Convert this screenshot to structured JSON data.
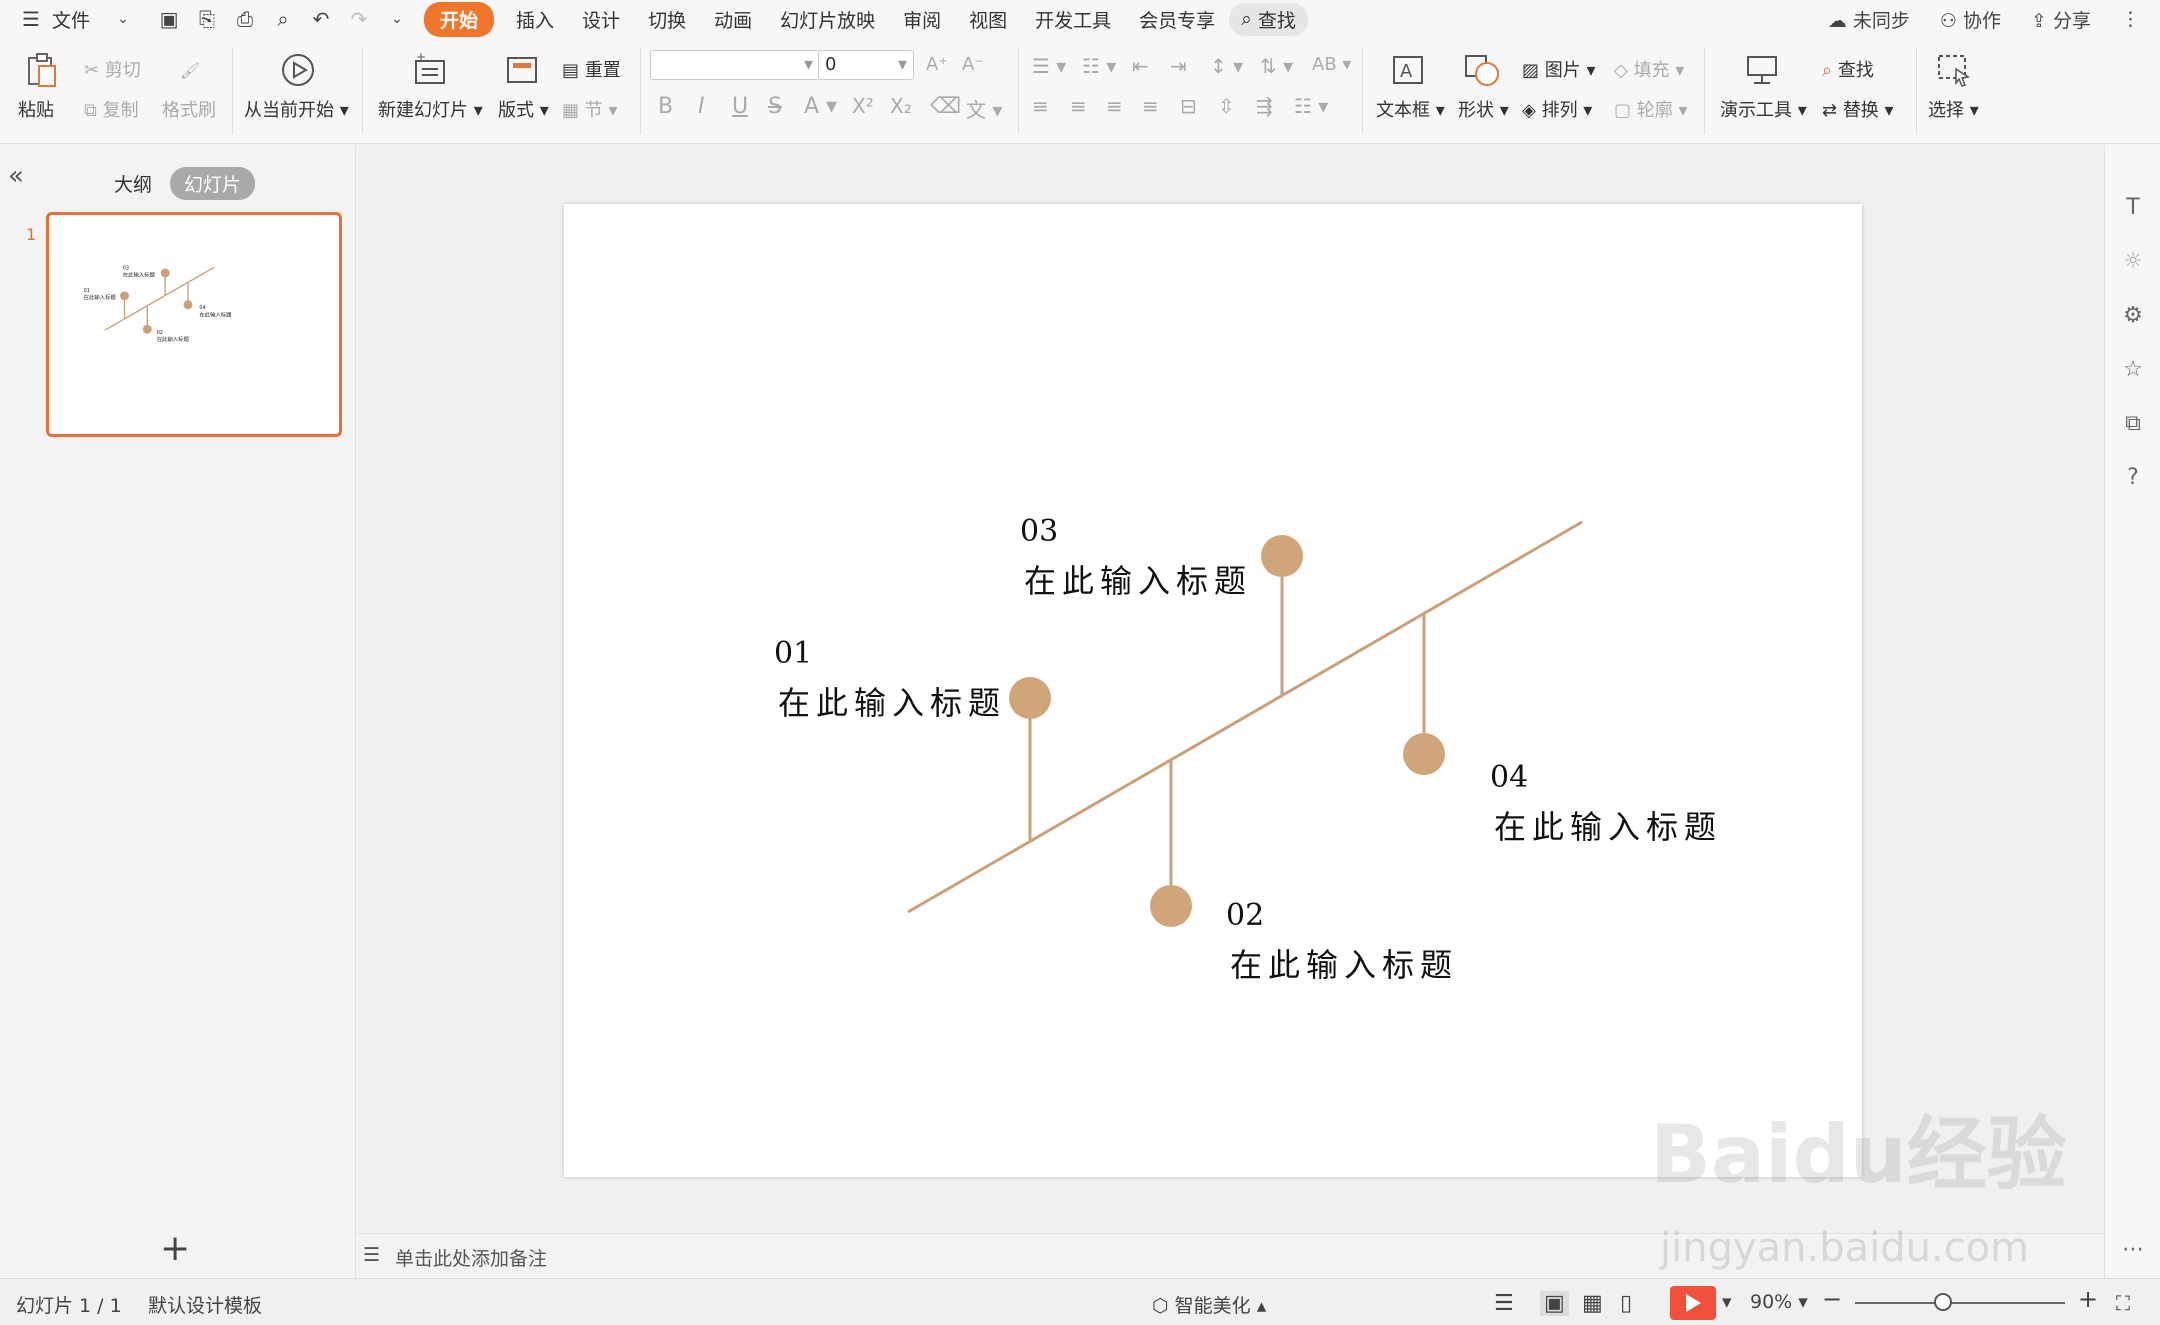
{
  "menubar": {
    "file": "文件",
    "tabs": [
      "开始",
      "插入",
      "设计",
      "切换",
      "动画",
      "幻灯片放映",
      "审阅",
      "视图",
      "开发工具",
      "会员专享"
    ],
    "search": "查找",
    "unsynced": "未同步",
    "collab": "协作",
    "share": "分享"
  },
  "ribbon": {
    "paste": "粘贴",
    "cut": "剪切",
    "copy": "复制",
    "format_painter": "格式刷",
    "play_from_current": "从当前开始",
    "new_slide": "新建幻灯片",
    "layout": "版式",
    "reset": "重置",
    "section": "节",
    "font_size": "0",
    "bold": "B",
    "italic": "I",
    "underline": "U",
    "strike": "S",
    "fontcolor": "A",
    "superscript": "X²",
    "subscript": "X₂",
    "textbox": "文本框",
    "shape": "形状",
    "picture": "图片",
    "fill": "填充",
    "arrange": "排列",
    "outline": "轮廓",
    "present_tools": "演示工具",
    "find": "查找",
    "replace": "替换",
    "select": "选择"
  },
  "leftpanel": {
    "outline_tab": "大纲",
    "slides_tab": "幻灯片",
    "slide_number": "1",
    "collapse": "«",
    "add": "+"
  },
  "slide": {
    "items": [
      {
        "num": "01",
        "title": "在此输入标题"
      },
      {
        "num": "02",
        "title": "在此输入标题"
      },
      {
        "num": "03",
        "title": "在此输入标题"
      },
      {
        "num": "04",
        "title": "在此输入标题"
      }
    ],
    "accent": "#c9a07a",
    "line_color": "#c9a07a"
  },
  "notes": {
    "placeholder": "单击此处添加备注"
  },
  "statusbar": {
    "slide_count": "幻灯片 1 / 1",
    "template": "默认设计模板",
    "beautify": "智能美化",
    "zoom": "90%"
  },
  "watermark": {
    "brand": "Baidu经验",
    "url": "jingyan.baidu.com"
  }
}
